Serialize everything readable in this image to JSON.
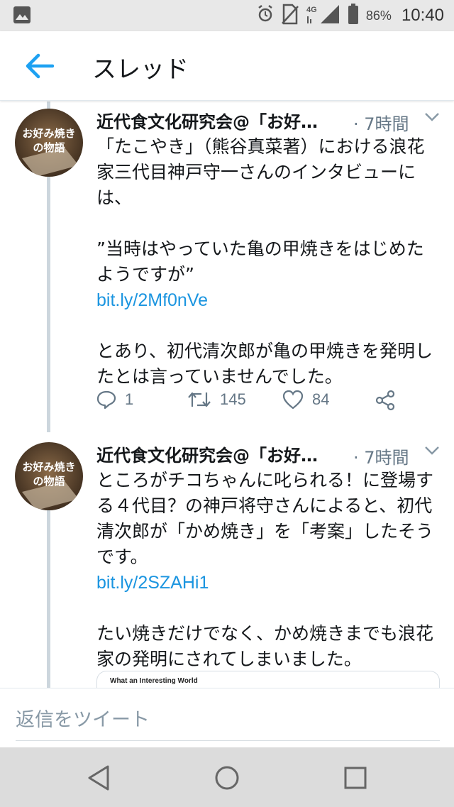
{
  "status_bar": {
    "network": "4G",
    "battery_percent": "86%",
    "time": "10:40"
  },
  "header": {
    "title": "スレッド"
  },
  "tweets": [
    {
      "author": "近代食文化研究会@「お好…",
      "time": "· 7時間",
      "avatar_text_top": "お好み焼き",
      "avatar_text_bottom": "の物語",
      "text_part1": "「たこやき」（熊谷真菜著）における浪花家三代目神戸守一さんのインタビューには、\n\n”当時はやっていた亀の甲焼きをはじめたようですが”",
      "link": "bit.ly/2Mf0nVe",
      "text_part2": "とあり、初代清次郎が亀の甲焼きを発明したとは言っていませんでした。",
      "replies": "1",
      "retweets": "145",
      "likes": "84"
    },
    {
      "author": "近代食文化研究会@「お好…",
      "time": "· 7時間",
      "avatar_text_top": "お好み焼き",
      "avatar_text_bottom": "の物語",
      "text_part1": "ところがチコちゃんに叱られる！に登場する４代目？の神戸将守さんによると、初代清次郎が「かめ焼き」を「考案」したそうです。",
      "link": "bit.ly/2SZAHi1",
      "text_part2": "たい焼きだけでなく、かめ焼きまでも浪花家の発明にされてしまいました。",
      "card_title": "What an Interesting World"
    }
  ],
  "reply_bar": {
    "placeholder": "返信をツイート"
  },
  "colors": {
    "accent": "#1da1f2",
    "link": "#1b95e0",
    "muted": "#657786",
    "thread_line": "#ccd6dd"
  }
}
